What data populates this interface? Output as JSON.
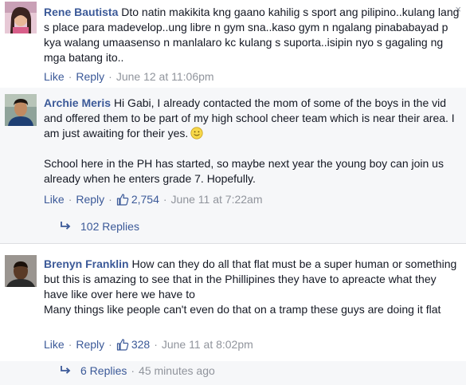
{
  "comments": [
    {
      "author": "Rene Bautista",
      "text": "Dto natin makikita kng gaano kahilig s sport ang pilipino..kulang lang s place para madevelop..ung libre n gym sna..kaso gym n ngalang pinababayad p kya walang umaasenso n manlalaro kc kulang s suporta..isipin nyo s gagaling ng mga batang ito..",
      "like_label": "Like",
      "reply_label": "Reply",
      "timestamp": "June 12 at 11:06pm"
    },
    {
      "author": "Archie Meris",
      "text_p1": "Hi Gabi, I already contacted the mom of some of the boys in the vid and offered them to be part of my high school cheer team which is near their area. I am just awaiting for their yes.",
      "text_p2": "School here in the PH has started, so maybe next year the young boy can join us already when he enters grade 7. Hopefully.",
      "like_label": "Like",
      "reply_label": "Reply",
      "like_count": "2,754",
      "timestamp": "June 11 at 7:22am",
      "replies_label": "102 Replies"
    },
    {
      "author": "Brenyn Franklin",
      "text_p1": "How can they do all that flat must be a super human or something but this is amazing to see that in the Phillipines they have to apreacte what they have like over here we have to",
      "text_p2": "Many things like people can't even do that on a tramp these guys are doing it flat",
      "like_label": "Like",
      "reply_label": "Reply",
      "like_count": "328",
      "timestamp": "June 11 at 8:02pm",
      "replies_label": "6 Replies",
      "replies_time": "45 minutes ago"
    }
  ],
  "close_label": "×",
  "colors": {
    "link": "#3b5998",
    "meta": "#90949c",
    "text": "#141823"
  }
}
